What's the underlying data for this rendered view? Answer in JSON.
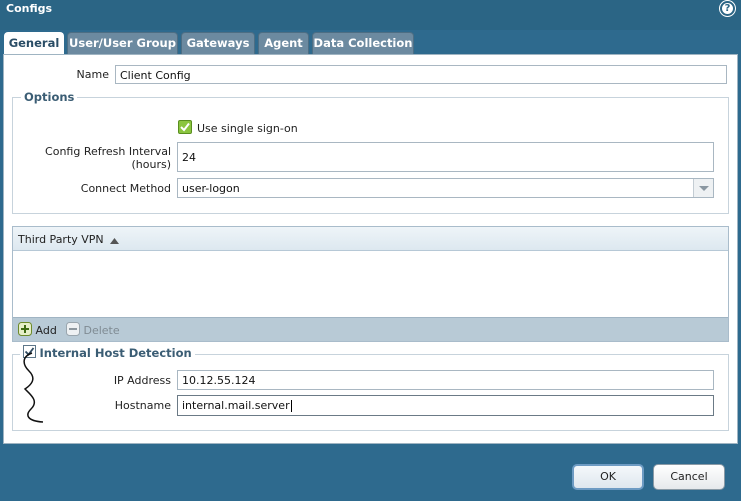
{
  "window": {
    "title": "Configs",
    "help_icon": "?"
  },
  "tabs": [
    {
      "label": "General",
      "active": true
    },
    {
      "label": "User/User Group",
      "active": false
    },
    {
      "label": "Gateways",
      "active": false
    },
    {
      "label": "Agent",
      "active": false
    },
    {
      "label": "Data Collection",
      "active": false
    }
  ],
  "general": {
    "name_label": "Name",
    "name_value": "Client Config",
    "options": {
      "legend": "Options",
      "sso_label": "Use single sign-on",
      "sso_checked": true,
      "refresh_label_line1": "Config Refresh Interval",
      "refresh_label_line2": "(hours)",
      "refresh_value": "24",
      "connect_label": "Connect Method",
      "connect_value": "user-logon"
    },
    "vpn_table": {
      "column": "Third Party VPN",
      "add_label": "Add",
      "delete_label": "Delete"
    },
    "host_detection": {
      "legend": "Internal Host Detection",
      "checked": true,
      "ip_label": "IP Address",
      "ip_value": "10.12.55.124",
      "hostname_label": "Hostname",
      "hostname_value": "internal.mail.server"
    }
  },
  "footer": {
    "ok_label": "OK",
    "cancel_label": "Cancel"
  },
  "colors": {
    "window_bg": "#2e6a8e",
    "tab_inactive": "#6c8aa0",
    "accent": "#3b5d74",
    "check_green": "#7cbf2a"
  }
}
